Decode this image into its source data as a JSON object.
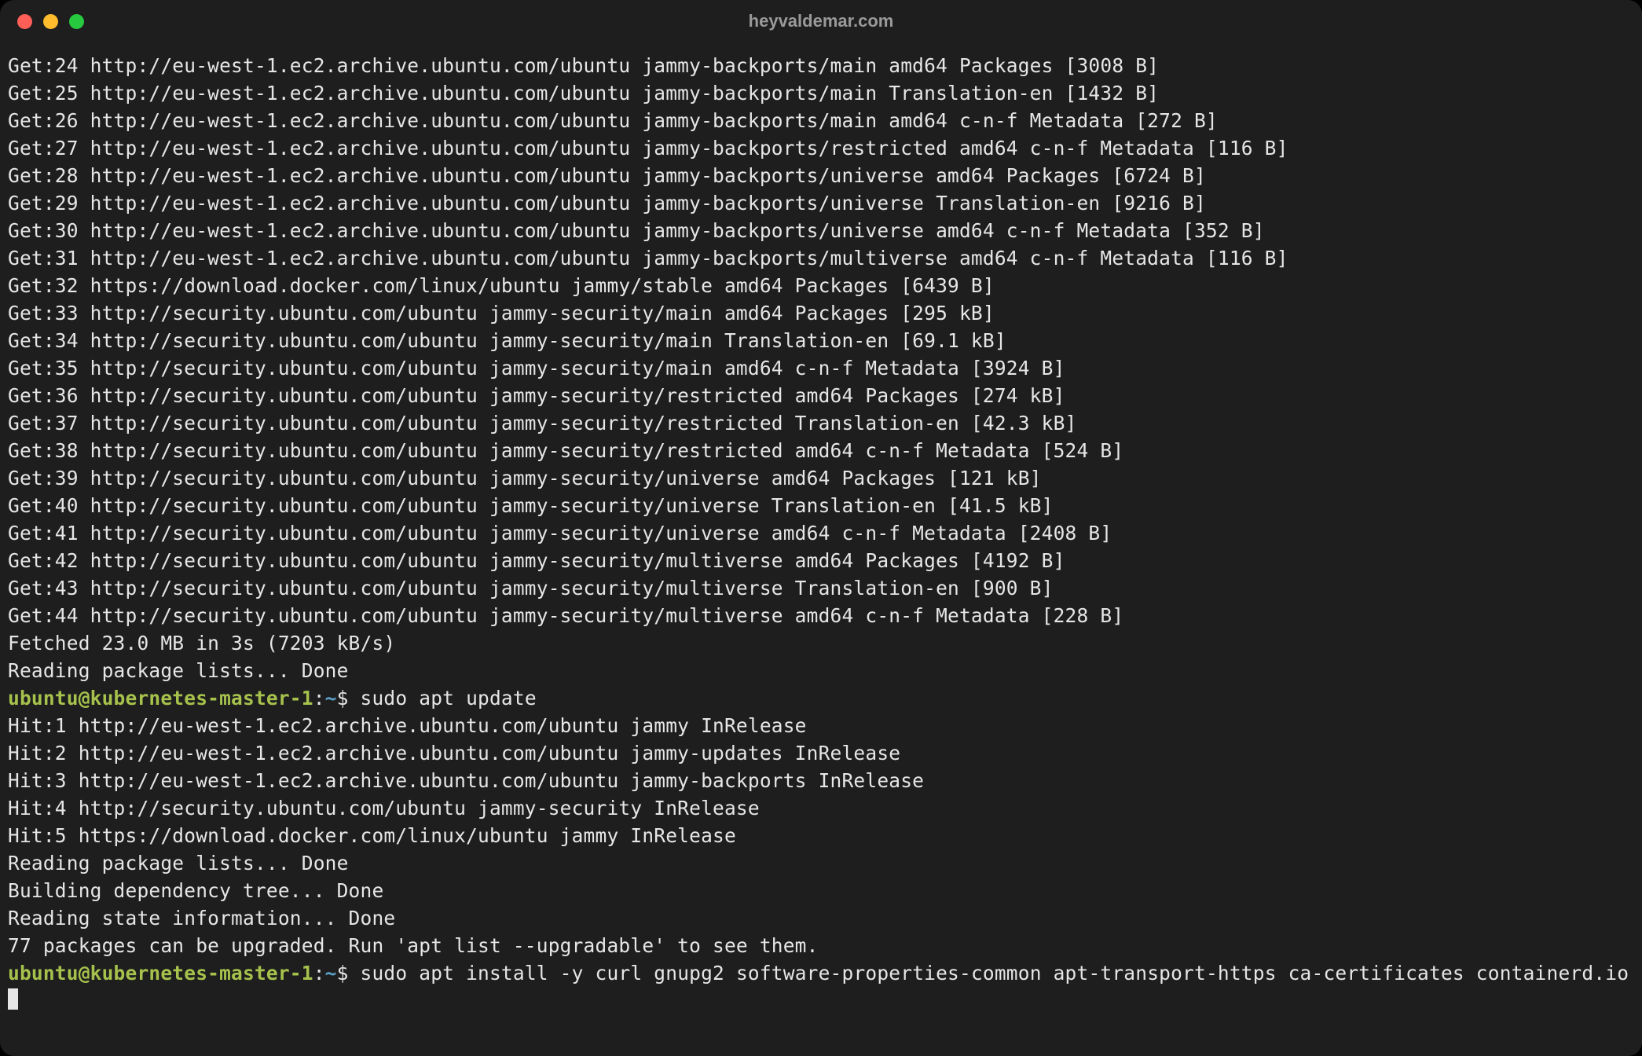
{
  "window": {
    "title": "heyvaldemar.com"
  },
  "colors": {
    "bg": "#1e1e1e",
    "text": "#e6e6e6",
    "promptUserHost": "#a6c24c",
    "promptPath": "#5aa0c8",
    "trafficRed": "#ff5f56",
    "trafficYellow": "#ffbd2e",
    "trafficGreen": "#27c93f"
  },
  "prompt": {
    "user": "ubuntu",
    "at": "@",
    "host": "kubernetes-master-1",
    "sep1": ":",
    "path": "~",
    "sep2": "$ "
  },
  "lines": [
    {
      "t": "out",
      "text": "Get:24 http://eu-west-1.ec2.archive.ubuntu.com/ubuntu jammy-backports/main amd64 Packages [3008 B]"
    },
    {
      "t": "out",
      "text": "Get:25 http://eu-west-1.ec2.archive.ubuntu.com/ubuntu jammy-backports/main Translation-en [1432 B]"
    },
    {
      "t": "out",
      "text": "Get:26 http://eu-west-1.ec2.archive.ubuntu.com/ubuntu jammy-backports/main amd64 c-n-f Metadata [272 B]"
    },
    {
      "t": "out",
      "text": "Get:27 http://eu-west-1.ec2.archive.ubuntu.com/ubuntu jammy-backports/restricted amd64 c-n-f Metadata [116 B]"
    },
    {
      "t": "out",
      "text": "Get:28 http://eu-west-1.ec2.archive.ubuntu.com/ubuntu jammy-backports/universe amd64 Packages [6724 B]"
    },
    {
      "t": "out",
      "text": "Get:29 http://eu-west-1.ec2.archive.ubuntu.com/ubuntu jammy-backports/universe Translation-en [9216 B]"
    },
    {
      "t": "out",
      "text": "Get:30 http://eu-west-1.ec2.archive.ubuntu.com/ubuntu jammy-backports/universe amd64 c-n-f Metadata [352 B]"
    },
    {
      "t": "out",
      "text": "Get:31 http://eu-west-1.ec2.archive.ubuntu.com/ubuntu jammy-backports/multiverse amd64 c-n-f Metadata [116 B]"
    },
    {
      "t": "out",
      "text": "Get:32 https://download.docker.com/linux/ubuntu jammy/stable amd64 Packages [6439 B]"
    },
    {
      "t": "out",
      "text": "Get:33 http://security.ubuntu.com/ubuntu jammy-security/main amd64 Packages [295 kB]"
    },
    {
      "t": "out",
      "text": "Get:34 http://security.ubuntu.com/ubuntu jammy-security/main Translation-en [69.1 kB]"
    },
    {
      "t": "out",
      "text": "Get:35 http://security.ubuntu.com/ubuntu jammy-security/main amd64 c-n-f Metadata [3924 B]"
    },
    {
      "t": "out",
      "text": "Get:36 http://security.ubuntu.com/ubuntu jammy-security/restricted amd64 Packages [274 kB]"
    },
    {
      "t": "out",
      "text": "Get:37 http://security.ubuntu.com/ubuntu jammy-security/restricted Translation-en [42.3 kB]"
    },
    {
      "t": "out",
      "text": "Get:38 http://security.ubuntu.com/ubuntu jammy-security/restricted amd64 c-n-f Metadata [524 B]"
    },
    {
      "t": "out",
      "text": "Get:39 http://security.ubuntu.com/ubuntu jammy-security/universe amd64 Packages [121 kB]"
    },
    {
      "t": "out",
      "text": "Get:40 http://security.ubuntu.com/ubuntu jammy-security/universe Translation-en [41.5 kB]"
    },
    {
      "t": "out",
      "text": "Get:41 http://security.ubuntu.com/ubuntu jammy-security/universe amd64 c-n-f Metadata [2408 B]"
    },
    {
      "t": "out",
      "text": "Get:42 http://security.ubuntu.com/ubuntu jammy-security/multiverse amd64 Packages [4192 B]"
    },
    {
      "t": "out",
      "text": "Get:43 http://security.ubuntu.com/ubuntu jammy-security/multiverse Translation-en [900 B]"
    },
    {
      "t": "out",
      "text": "Get:44 http://security.ubuntu.com/ubuntu jammy-security/multiverse amd64 c-n-f Metadata [228 B]"
    },
    {
      "t": "out",
      "text": "Fetched 23.0 MB in 3s (7203 kB/s)"
    },
    {
      "t": "out",
      "text": "Reading package lists... Done"
    },
    {
      "t": "prompt",
      "cmd": "sudo apt update"
    },
    {
      "t": "out",
      "text": "Hit:1 http://eu-west-1.ec2.archive.ubuntu.com/ubuntu jammy InRelease"
    },
    {
      "t": "out",
      "text": "Hit:2 http://eu-west-1.ec2.archive.ubuntu.com/ubuntu jammy-updates InRelease"
    },
    {
      "t": "out",
      "text": "Hit:3 http://eu-west-1.ec2.archive.ubuntu.com/ubuntu jammy-backports InRelease"
    },
    {
      "t": "out",
      "text": "Hit:4 http://security.ubuntu.com/ubuntu jammy-security InRelease"
    },
    {
      "t": "out",
      "text": "Hit:5 https://download.docker.com/linux/ubuntu jammy InRelease"
    },
    {
      "t": "out",
      "text": "Reading package lists... Done"
    },
    {
      "t": "out",
      "text": "Building dependency tree... Done"
    },
    {
      "t": "out",
      "text": "Reading state information... Done"
    },
    {
      "t": "out",
      "text": "77 packages can be upgraded. Run 'apt list --upgradable' to see them."
    },
    {
      "t": "prompt",
      "cmd": "sudo apt install -y curl gnupg2 software-properties-common apt-transport-https ca-certificates containerd.io",
      "cursor": true
    }
  ]
}
